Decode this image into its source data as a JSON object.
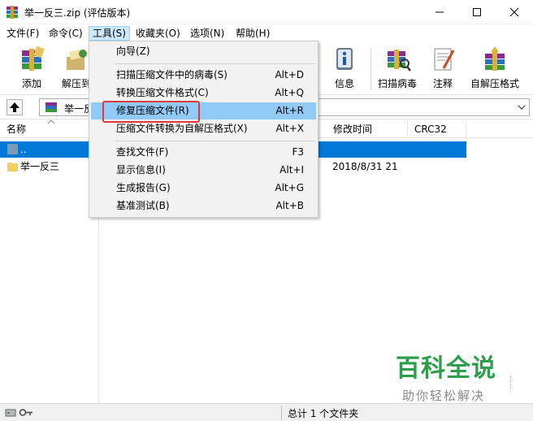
{
  "window": {
    "title": "举一反三.zip (评估版本)",
    "controls": {
      "minimize": "—",
      "maximize": "☐",
      "close": "✕"
    }
  },
  "menubar": {
    "items": [
      {
        "label": "文件(F)"
      },
      {
        "label": "命令(C)"
      },
      {
        "label": "工具(S)"
      },
      {
        "label": "收藏夹(O)"
      },
      {
        "label": "选项(N)"
      },
      {
        "label": "帮助(H)"
      }
    ]
  },
  "toolbar": {
    "items": [
      {
        "label": "添加",
        "icon": "add-archive-icon"
      },
      {
        "label": "解压到",
        "icon": "extract-to-icon"
      },
      {
        "label": "信息",
        "icon": "info-icon"
      },
      {
        "label": "扫描病毒",
        "icon": "virus-scan-icon"
      },
      {
        "label": "注释",
        "icon": "comment-icon"
      },
      {
        "label": "自解压格式",
        "icon": "sfx-icon"
      }
    ]
  },
  "addressbar": {
    "path": "举一反"
  },
  "columns": {
    "name": "名称",
    "modified": "修改时间",
    "crc": "CRC32"
  },
  "files": [
    {
      "name": "..",
      "modified": "",
      "selected": true
    },
    {
      "name": "举一反三",
      "modified": "2018/8/31 21",
      "selected": false
    }
  ],
  "tools_menu": {
    "items": [
      {
        "label": "向导(Z)",
        "shortcut": ""
      },
      {
        "label": "扫描压缩文件中的病毒(S)",
        "shortcut": "Alt+D"
      },
      {
        "label": "转换压缩文件格式(C)",
        "shortcut": "Alt+Q"
      },
      {
        "label": "修复压缩文件(R)",
        "shortcut": "Alt+R"
      },
      {
        "label": "压缩文件转换为自解压格式(X)",
        "shortcut": "Alt+X"
      },
      {
        "label": "查找文件(F)",
        "shortcut": "F3"
      },
      {
        "label": "显示信息(I)",
        "shortcut": "Alt+I"
      },
      {
        "label": "生成报告(G)",
        "shortcut": "Alt+G"
      },
      {
        "label": "基准测试(B)",
        "shortcut": "Alt+B"
      }
    ]
  },
  "statusbar": {
    "text": "总计 1 个文件夹"
  },
  "watermark": {
    "main": "百科全说",
    "sub": "助你轻松解决"
  }
}
